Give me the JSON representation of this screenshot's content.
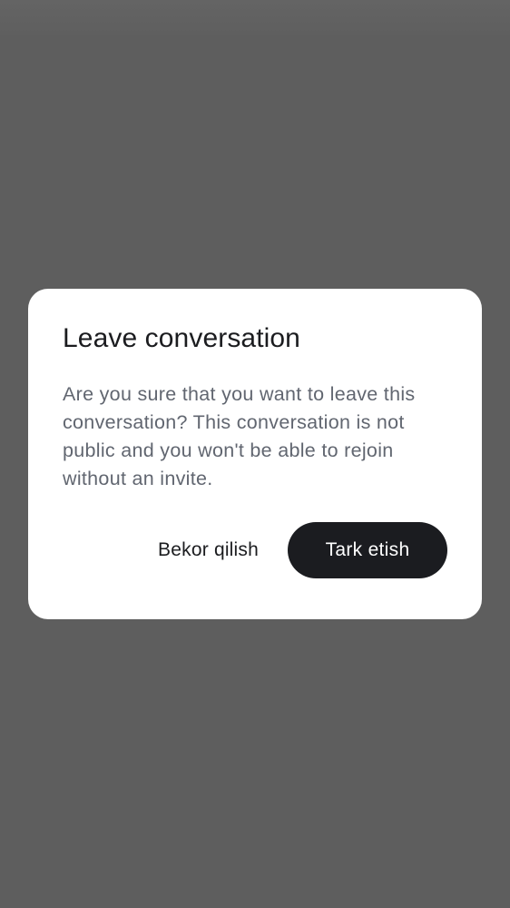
{
  "dialog": {
    "title": "Leave conversation",
    "message": "Are you sure that you want to leave this conversation? This conversation is not public and you won't be able to rejoin without an invite.",
    "cancel_label": "Bekor qilish",
    "confirm_label": "Tark etish"
  },
  "colors": {
    "scrim": "#5e5e5e",
    "dialog_bg": "#ffffff",
    "primary_button": "#1b1c20",
    "title_text": "#1b1c1f",
    "body_text": "#616670"
  }
}
